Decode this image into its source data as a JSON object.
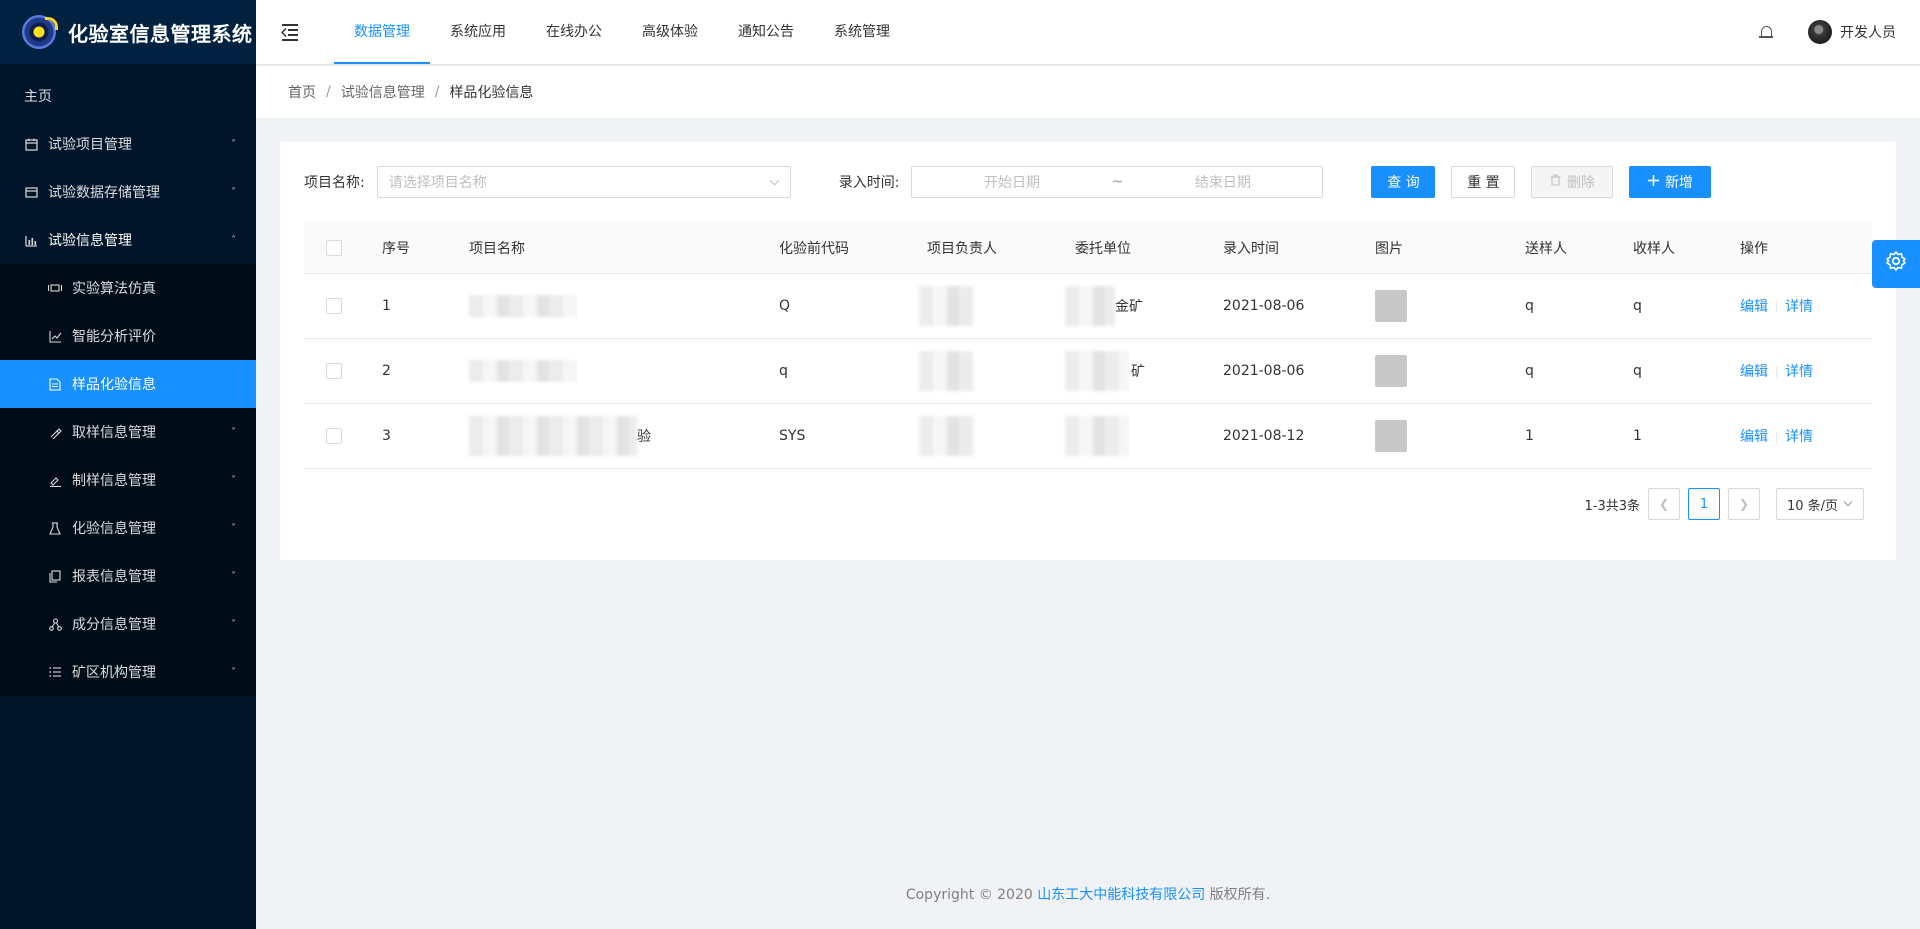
{
  "app": {
    "title": "化验室信息管理系统"
  },
  "sidebar": {
    "items": [
      {
        "label": "主页",
        "icon": "home",
        "level": 0,
        "arrow": ""
      },
      {
        "label": "试验项目管理",
        "icon": "calendar-icon",
        "level": 0,
        "arrow": "˅"
      },
      {
        "label": "试验数据存储管理",
        "icon": "database-icon",
        "level": 0,
        "arrow": "˅"
      },
      {
        "label": "试验信息管理",
        "icon": "bar-chart-icon",
        "level": 0,
        "arrow": "˄",
        "open": true
      },
      {
        "label": "实验算法仿真",
        "icon": "code-icon",
        "level": 1,
        "arrow": ""
      },
      {
        "label": "智能分析评价",
        "icon": "line-chart-icon",
        "level": 1,
        "arrow": ""
      },
      {
        "label": "样品化验信息",
        "icon": "file-icon",
        "level": 1,
        "arrow": "",
        "active": true
      },
      {
        "label": "取样信息管理",
        "icon": "pipette-icon",
        "level": 1,
        "arrow": "˅"
      },
      {
        "label": "制样信息管理",
        "icon": "tools-icon",
        "level": 1,
        "arrow": "˅"
      },
      {
        "label": "化验信息管理",
        "icon": "flask-icon",
        "level": 1,
        "arrow": "˅"
      },
      {
        "label": "报表信息管理",
        "icon": "copy-icon",
        "level": 1,
        "arrow": "˅"
      },
      {
        "label": "成分信息管理",
        "icon": "cluster-icon",
        "level": 1,
        "arrow": "˅"
      },
      {
        "label": "矿区机构管理",
        "icon": "list-icon",
        "level": 1,
        "arrow": "˅"
      }
    ]
  },
  "header": {
    "nav": [
      "数据管理",
      "系统应用",
      "在线办公",
      "高级体验",
      "通知公告",
      "系统管理"
    ],
    "active_nav": 0,
    "user": "开发人员"
  },
  "breadcrumb": [
    "首页",
    "试验信息管理",
    "样品化验信息"
  ],
  "filter": {
    "project_label": "项目名称:",
    "project_placeholder": "请选择项目名称",
    "date_label": "录入时间:",
    "start_placeholder": "开始日期",
    "separator": "~",
    "end_placeholder": "结束日期",
    "query_label": "查 询",
    "reset_label": "重 置",
    "delete_label": "删除",
    "add_label": "新增"
  },
  "table": {
    "columns": [
      "序号",
      "项目名称",
      "化验前代码",
      "项目负责人",
      "委托单位",
      "录入时间",
      "图片",
      "送样人",
      "收样人",
      "操作"
    ],
    "rows": [
      {
        "idx": "1",
        "name": "",
        "code": "Q",
        "owner": "",
        "unit": "金矿",
        "time": "2021-08-06",
        "send": "q",
        "recv": "q"
      },
      {
        "idx": "2",
        "name": "",
        "code": "q",
        "owner": "",
        "unit": "矿",
        "time": "2021-08-06",
        "send": "q",
        "recv": "q"
      },
      {
        "idx": "3",
        "name": "验",
        "code": "SYS",
        "owner": "",
        "unit": "",
        "time": "2021-08-12",
        "send": "1",
        "recv": "1"
      }
    ],
    "edit_label": "编辑",
    "detail_label": "详情"
  },
  "pagination": {
    "summary": "1-3共3条",
    "current": "1",
    "page_size": "10 条/页"
  },
  "footer": {
    "prefix": "Copyright © 2020 ",
    "company": "山东工大中能科技有限公司",
    "suffix": " 版权所有."
  },
  "colors": {
    "primary": "#1890ff",
    "sidebar_bg": "#001529",
    "submenu_bg": "#000c17"
  }
}
